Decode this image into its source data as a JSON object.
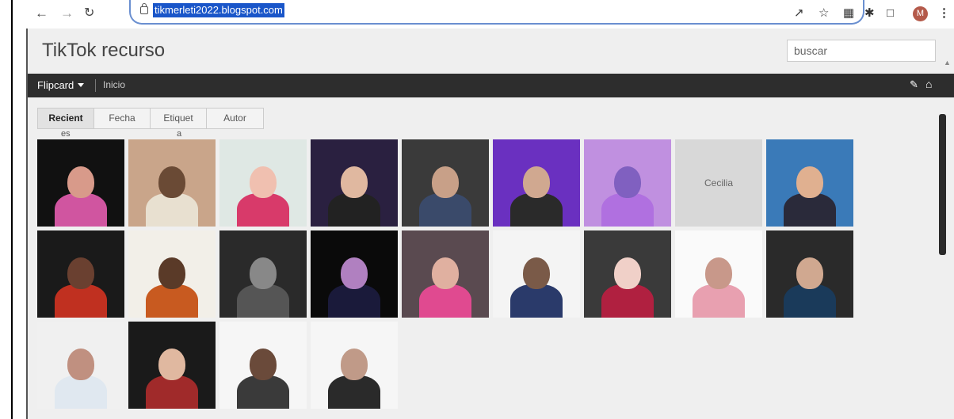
{
  "browser": {
    "url": "tikmerleti2022.blogspot.com",
    "profile_initial": "M",
    "icons": [
      "share-icon",
      "star-icon",
      "extension-icon",
      "puzzle-icon",
      "sidepanel-icon",
      "menu-icon"
    ]
  },
  "blog": {
    "title": "TikTok recurso",
    "search_placeholder": "buscar"
  },
  "navbar": {
    "brand": "Flipcard",
    "link": "Inicio"
  },
  "tabs": [
    {
      "label": "Recient",
      "overflow": "es",
      "active": true
    },
    {
      "label": "Fecha",
      "overflow": "",
      "active": false
    },
    {
      "label": "Etiquet",
      "overflow": "a",
      "active": false
    },
    {
      "label": "Autor",
      "overflow": "",
      "active": false
    }
  ],
  "grid": {
    "placeholder_caption": "Cecilia",
    "items": [
      {
        "bg": "#111111",
        "face": "#d89a8a",
        "shirt": "#d055a0"
      },
      {
        "bg": "#c9a58a",
        "face": "#6a4a35",
        "shirt": "#e8e0d0"
      },
      {
        "bg": "#dfe8e4",
        "face": "#f0c0b0",
        "shirt": "#d83a6a"
      },
      {
        "bg": "#2a2040",
        "face": "#e0b8a0",
        "shirt": "#222222"
      },
      {
        "bg": "#3a3a3a",
        "face": "#c8a088",
        "shirt": "#3a4a6a"
      },
      {
        "bg": "#6a30c0",
        "face": "#d0a890",
        "shirt": "#2a2a2a"
      },
      {
        "bg": "#c090e0",
        "face": "#8060c0",
        "shirt": "#b070e0"
      },
      {
        "bg": "#d8d8d8",
        "face": "",
        "shirt": "",
        "placeholder": true
      },
      {
        "bg": "#3a7ab8",
        "face": "#e0b090",
        "shirt": "#2a2a3a"
      },
      {
        "bg": "#1a1a1a",
        "face": "#6a4030",
        "shirt": "#c03020"
      },
      {
        "bg": "#f2efe8",
        "face": "#5a3a28",
        "shirt": "#c85a20"
      },
      {
        "bg": "#2a2a2a",
        "face": "#888888",
        "shirt": "#555555"
      },
      {
        "bg": "#0a0a0a",
        "face": "#b080c0",
        "shirt": "#1a1a3a"
      },
      {
        "bg": "#5a4a50",
        "face": "#e0b0a0",
        "shirt": "#e04a90"
      },
      {
        "bg": "#f4f4f4",
        "face": "#7a5a48",
        "shirt": "#2a3a6a"
      },
      {
        "bg": "#3a3a3a",
        "face": "#f0d0c8",
        "shirt": "#b02040"
      },
      {
        "bg": "#fafafa",
        "face": "#c8988a",
        "shirt": "#e8a0b0"
      },
      {
        "bg": "#2a2a2a",
        "face": "#d0a890",
        "shirt": "#1a3a5a"
      },
      {
        "bg": "#f0f0f0",
        "face": "#c09080",
        "shirt": "#e0e8f0"
      },
      {
        "bg": "#1a1a1a",
        "face": "#e0b8a0",
        "shirt": "#a02a2a"
      },
      {
        "bg": "#f6f6f6",
        "face": "#6a4a3a",
        "shirt": "#3a3a3a"
      },
      {
        "bg": "#f6f6f6",
        "face": "#c09a88",
        "shirt": "#2a2a2a"
      }
    ]
  }
}
